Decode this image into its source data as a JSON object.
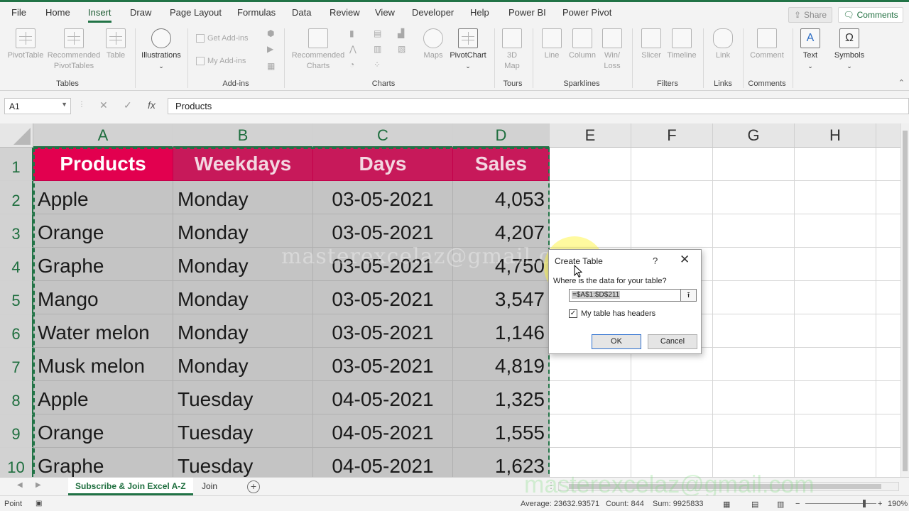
{
  "menu": {
    "tabs": [
      "File",
      "Home",
      "Insert",
      "Draw",
      "Page Layout",
      "Formulas",
      "Data",
      "Review",
      "View",
      "Developer",
      "Help",
      "Power BI",
      "Power Pivot"
    ],
    "active_tab": "Insert",
    "share_label": "Share",
    "comments_label": "Comments"
  },
  "ribbon": {
    "groups": {
      "tables": "Tables",
      "addins": "Add-ins",
      "charts": "Charts",
      "tours": "Tours",
      "sparklines": "Sparklines",
      "filters": "Filters",
      "links": "Links",
      "comments": "Comments"
    },
    "pivottable": "PivotTable",
    "recommended_pivottables": "Recommended PivotTables",
    "table": "Table",
    "illustrations": "Illustrations",
    "get_addins": "Get Add-ins",
    "my_addins": "My Add-ins",
    "recommended_charts": "Recommended Charts",
    "maps": "Maps",
    "pivotchart": "PivotChart",
    "map3d": "3D Map",
    "line": "Line",
    "column": "Column",
    "winloss": "Win/ Loss",
    "slicer": "Slicer",
    "timeline": "Timeline",
    "link": "Link",
    "comment": "Comment",
    "text": "Text",
    "symbols": "Symbols"
  },
  "formula_bar": {
    "name_box": "A1",
    "fx": "fx",
    "content": "Products"
  },
  "grid": {
    "columns": [
      "A",
      "B",
      "C",
      "D",
      "E",
      "F",
      "G",
      "H"
    ],
    "rows": [
      "1",
      "2",
      "3",
      "4",
      "5",
      "6",
      "7",
      "8",
      "9",
      "10"
    ],
    "headers": [
      "Products",
      "Weekdays",
      "Days",
      "Sales"
    ],
    "data": [
      [
        "Apple",
        "Monday",
        "03-05-2021",
        "4,053"
      ],
      [
        "Orange",
        "Monday",
        "03-05-2021",
        "4,207"
      ],
      [
        "Graphe",
        "Monday",
        "03-05-2021",
        "4,750"
      ],
      [
        "Mango",
        "Monday",
        "03-05-2021",
        "3,547"
      ],
      [
        "Water melon",
        "Monday",
        "03-05-2021",
        "1,146"
      ],
      [
        "Musk melon",
        "Monday",
        "03-05-2021",
        "4,819"
      ],
      [
        "Apple",
        "Tuesday",
        "04-05-2021",
        "1,325"
      ],
      [
        "Orange",
        "Tuesday",
        "04-05-2021",
        "1,555"
      ],
      [
        "Graphe",
        "Tuesday",
        "04-05-2021",
        "1,623"
      ]
    ],
    "header_color": "#e2004f",
    "accent": "#217346"
  },
  "dialog": {
    "title": "Create Table",
    "help": "?",
    "close": "✕",
    "prompt": "Where is the data for your table?",
    "range": "=$A$1:$D$211",
    "headers_label": "My table has headers",
    "headers_checked": true,
    "ok": "OK",
    "cancel": "Cancel"
  },
  "watermark": "masterexcelaz@gmail.com",
  "sheets": {
    "tabs": [
      "Subscribe & Join Excel A-Z",
      "Join"
    ],
    "active": "Subscribe & Join Excel A-Z"
  },
  "status": {
    "mode": "Point",
    "average": "Average: 23632.93571",
    "count": "Count: 844",
    "sum": "Sum: 9925833",
    "zoom": "190%"
  }
}
